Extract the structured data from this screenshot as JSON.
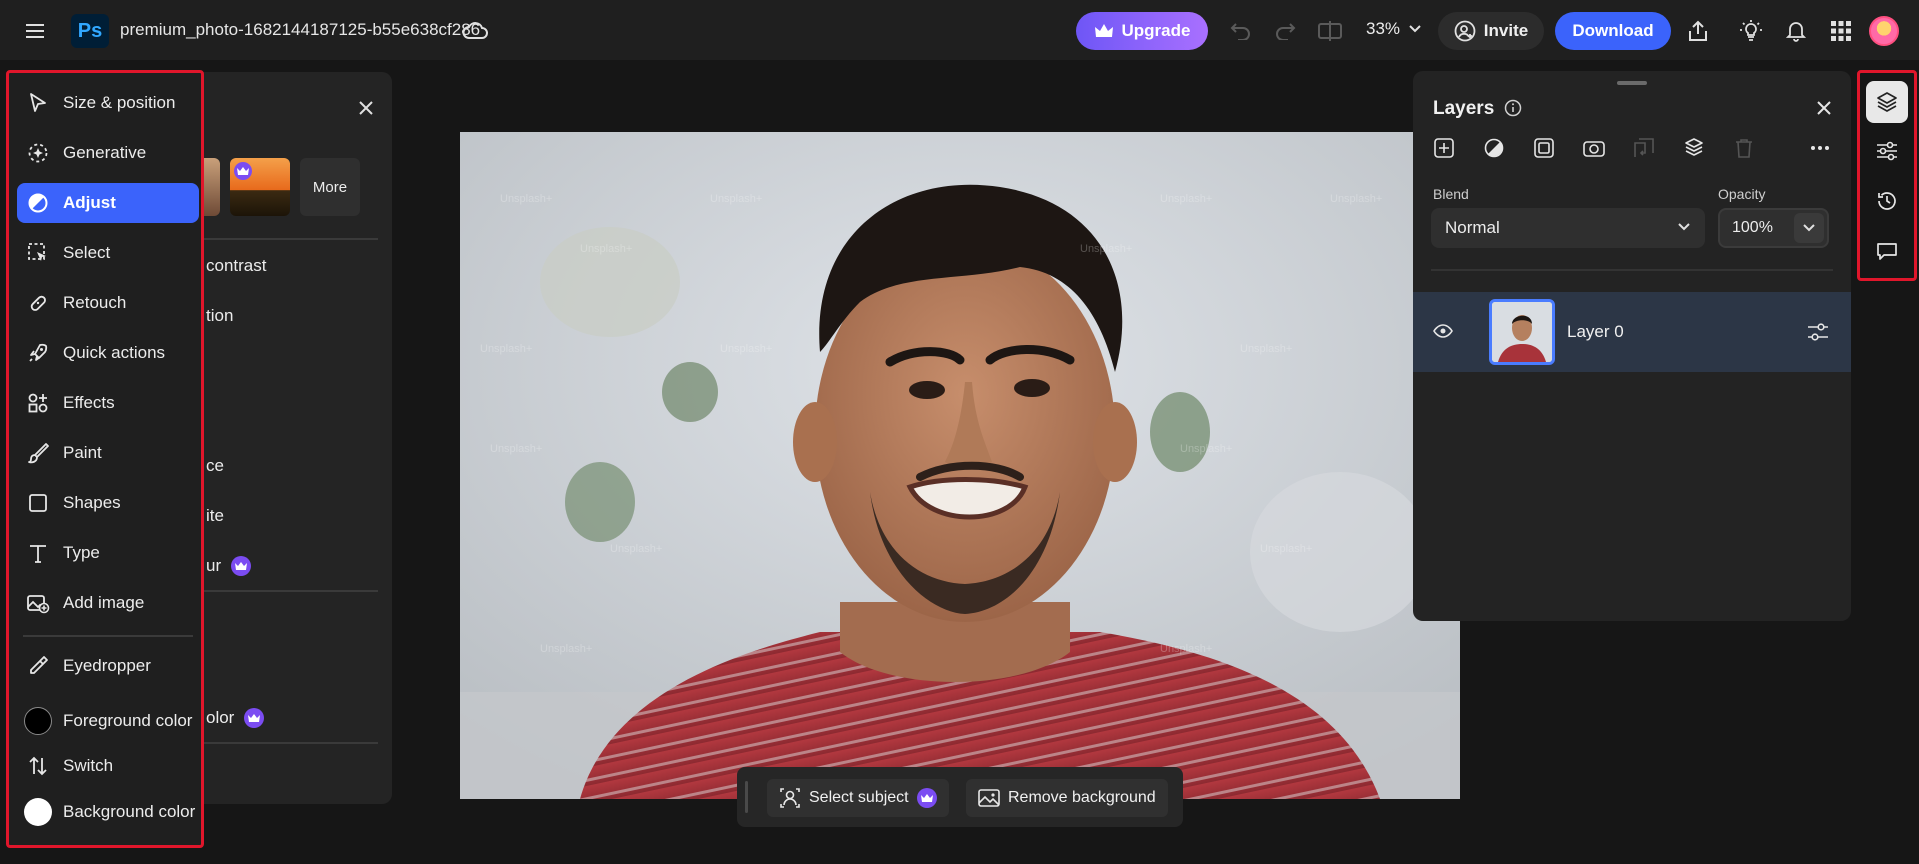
{
  "topbar": {
    "app_logo": "Ps",
    "doc_title": "premium_photo-1682144187125-b55e638cf286",
    "upgrade_label": "Upgrade",
    "zoom_value": "33%",
    "invite_label": "Invite",
    "download_label": "Download"
  },
  "toolbar": {
    "items": [
      {
        "label": "Size & position",
        "icon": "size-position-icon"
      },
      {
        "label": "Generative",
        "icon": "generative-icon"
      },
      {
        "label": "Adjust",
        "icon": "adjust-icon",
        "active": true
      },
      {
        "label": "Select",
        "icon": "select-icon"
      },
      {
        "label": "Retouch",
        "icon": "retouch-icon"
      },
      {
        "label": "Quick actions",
        "icon": "rocket-icon"
      },
      {
        "label": "Effects",
        "icon": "effects-icon"
      },
      {
        "label": "Paint",
        "icon": "brush-icon"
      },
      {
        "label": "Shapes",
        "icon": "square-icon"
      },
      {
        "label": "Type",
        "icon": "type-icon"
      },
      {
        "label": "Add image",
        "icon": "add-image-icon"
      }
    ],
    "bottom_items": [
      {
        "label": "Eyedropper",
        "icon": "eyedropper-icon"
      },
      {
        "label": "Foreground color",
        "color": "#000000"
      },
      {
        "label": "Switch",
        "icon": "switch-icon"
      },
      {
        "label": "Background color",
        "color": "#ffffff"
      }
    ]
  },
  "adjust_panel": {
    "more_label": "More",
    "partial_items": [
      "contrast",
      "tion",
      "ce",
      "ite",
      "ur",
      "olor"
    ]
  },
  "canvas": {
    "watermark": "Unsplash+"
  },
  "bottom_bar": {
    "select_subject_label": "Select subject",
    "remove_background_label": "Remove background"
  },
  "layers_panel": {
    "title": "Layers",
    "blend_label": "Blend",
    "blend_value": "Normal",
    "opacity_label": "Opacity",
    "opacity_value": "100%",
    "layers": [
      {
        "name": "Layer 0",
        "visible": true
      }
    ]
  },
  "colors": {
    "accent": "#3b63fb",
    "upgrade_gradient_start": "#6e56f6",
    "upgrade_gradient_end": "#a970ff",
    "highlight_border": "#e0162b",
    "premium_crown": "#7b4cf2"
  }
}
